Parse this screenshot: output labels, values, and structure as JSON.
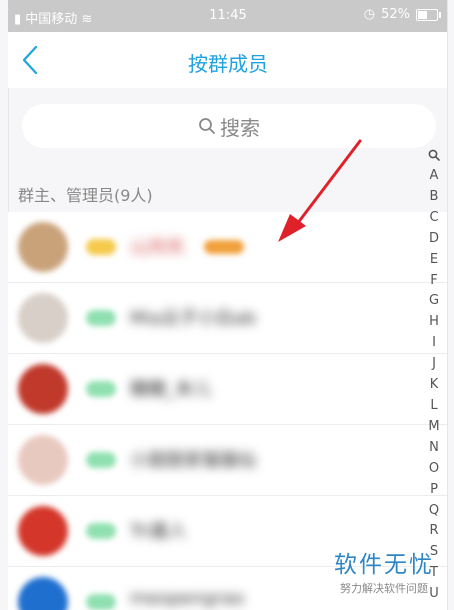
{
  "status_bar": {
    "carrier": "中国移动",
    "time": "11:45",
    "battery": "52%"
  },
  "nav": {
    "title": "按群成员"
  },
  "search": {
    "placeholder": "搜索"
  },
  "section": {
    "header": "群主、管理员(9人)"
  },
  "members": [
    {
      "nickname": "山岚岚",
      "avatar_color": "#c9a27a",
      "tag_color": "#f5c94a",
      "has_badge": true
    },
    {
      "nickname": "Mia云子小白ab",
      "avatar_color": "#d8cfc8",
      "tag_color": "#8fe0b0",
      "has_badge": false
    },
    {
      "nickname": "糖糖_本儿",
      "avatar_color": "#c0392b",
      "tag_color": "#8fe0b0",
      "has_badge": false
    },
    {
      "nickname": "小甜甜家猫猫仙",
      "avatar_color": "#e8c9c0",
      "tag_color": "#8fe0b0",
      "has_badge": false
    },
    {
      "nickname": "Tri嘉人",
      "avatar_color": "#d4362a",
      "tag_color": "#8fe0b0",
      "has_badge": false
    },
    {
      "nickname": "meopengrao",
      "avatar_color": "#1f6fcf",
      "tag_color": "#8fe0b0",
      "has_badge": false
    }
  ],
  "alphabet_index": [
    "A",
    "B",
    "C",
    "D",
    "E",
    "F",
    "G",
    "H",
    "I",
    "J",
    "K",
    "L",
    "M",
    "N",
    "O",
    "P",
    "Q",
    "R",
    "S",
    "T",
    "U"
  ],
  "watermark": {
    "brand": "软件无忧",
    "slogan": "努力解决软件问题"
  },
  "colors": {
    "accent": "#1fa2e0",
    "annotation_arrow": "#e0212a"
  }
}
